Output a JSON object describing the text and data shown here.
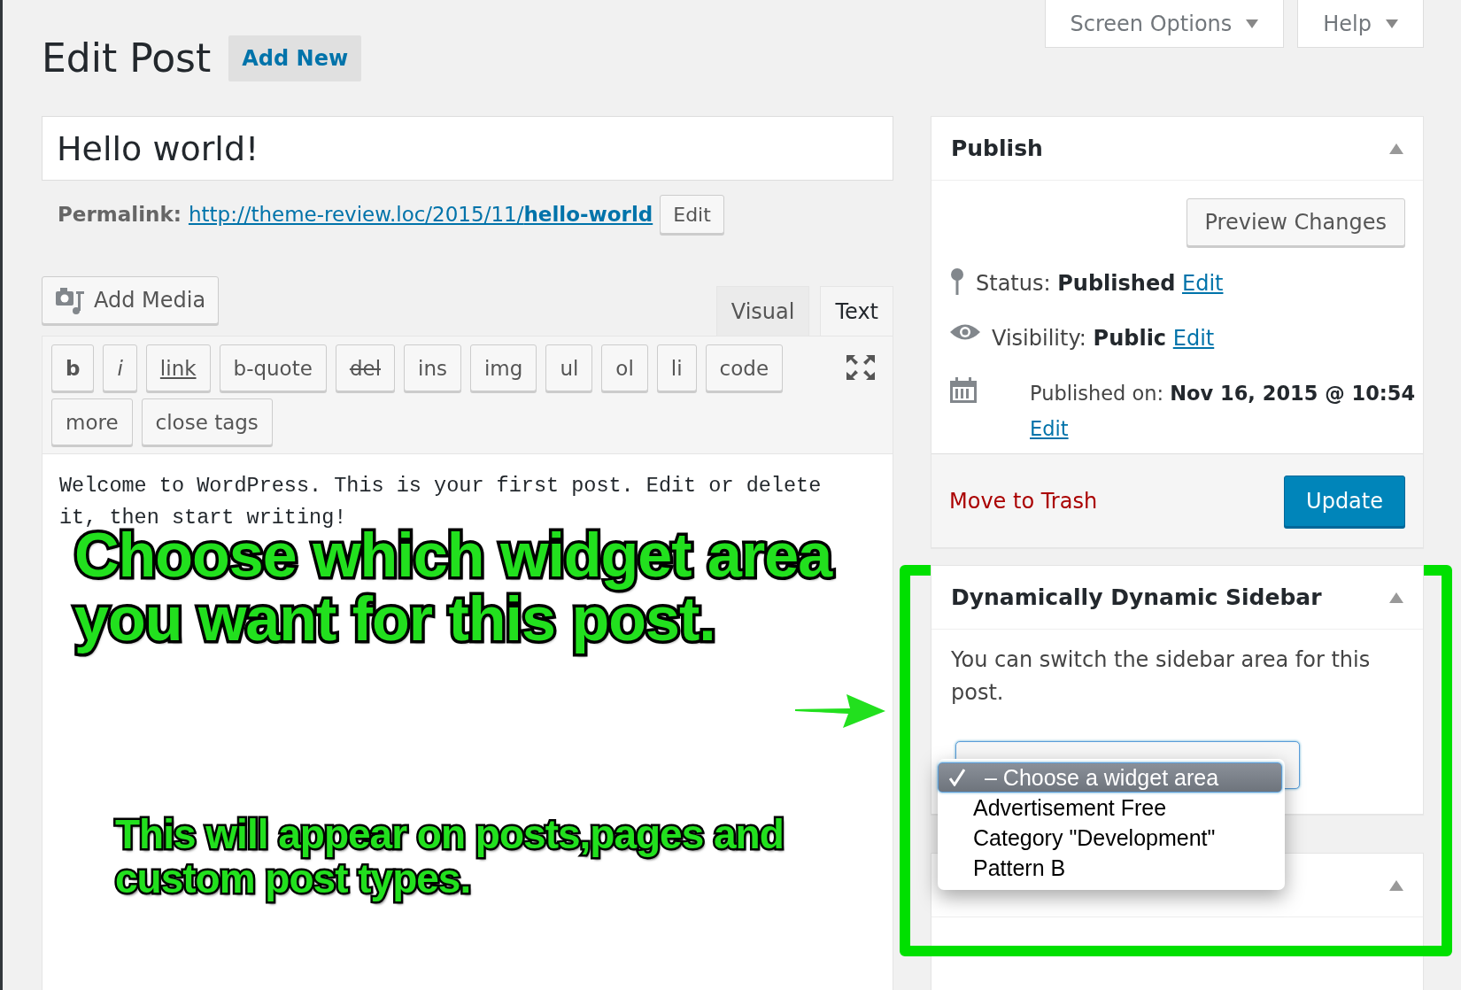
{
  "page_title": "Edit Post",
  "add_new": "Add New",
  "header_tabs": [
    {
      "label": "Screen Options"
    },
    {
      "label": "Help"
    }
  ],
  "post_title": "Hello world!",
  "permalink": {
    "label": "Permalink:",
    "url": "http://theme-review.loc/2015/11/**hello-world**",
    "edit": "Edit"
  },
  "add_media": "Add Media",
  "editor_tabs": [
    {
      "label": "Visual",
      "selected": false
    },
    {
      "label": "Text",
      "selected": true
    }
  ],
  "quicktags": [
    {
      "label": "b",
      "kind": "bold"
    },
    {
      "label": "i",
      "kind": "italic"
    },
    {
      "label": "link",
      "kind": "link"
    },
    {
      "label": "b-quote",
      "kind": "plain"
    },
    {
      "label": "del",
      "kind": "del"
    },
    {
      "label": "ins",
      "kind": "plain"
    },
    {
      "label": "img",
      "kind": "plain"
    },
    {
      "label": "ul",
      "kind": "plain"
    },
    {
      "label": "ol",
      "kind": "plain"
    },
    {
      "label": "li",
      "kind": "plain"
    },
    {
      "label": "code",
      "kind": "plain"
    },
    {
      "label": "more",
      "kind": "plain"
    },
    {
      "label": "close tags",
      "kind": "plain"
    }
  ],
  "content": "Welcome to WordPress. This is your first post. Edit or delete it, then start writing!",
  "publish": {
    "title": "Publish",
    "preview": "Preview Changes",
    "rows": [
      {
        "kind": "status",
        "label": "Status:",
        "value": "Published",
        "edit": "Edit"
      },
      {
        "kind": "visibility",
        "label": "Visibility:",
        "value": "Public",
        "edit": "Edit"
      },
      {
        "kind": "date",
        "label": "Published on:",
        "value": "Nov 16, 2015 @ 10:54",
        "edit": "Edit"
      }
    ],
    "trash": "Move to Trash",
    "update": "Update"
  },
  "sidebar_box": {
    "title": "Dynamically Dynamic Sidebar",
    "description": "You can switch the sidebar area for this post.",
    "dropdown": {
      "options": [
        {
          "label": "– Choose a widget area",
          "selected": true
        },
        {
          "label": "Advertisement Free",
          "selected": false
        },
        {
          "label": "Category \"Development\"",
          "selected": false
        },
        {
          "label": "Pattern B",
          "selected": false
        }
      ]
    }
  },
  "annotations": [
    {
      "text": "Choose which widget area you want for this post.",
      "kind": "large"
    },
    {
      "text": "This will appear on posts,pages and custom post types.",
      "kind": "small"
    }
  ]
}
